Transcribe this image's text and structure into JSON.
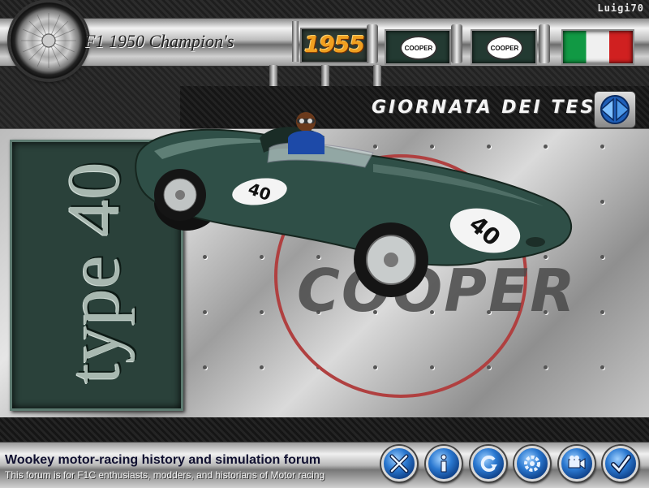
{
  "header": {
    "user_name": "Luigi70",
    "app_title": "F1 1950 Champion's",
    "year": "1955",
    "team_logo_1": "COOPER",
    "team_logo_2": "COOPER",
    "flag": "italy-flag"
  },
  "screen": {
    "title": "GIORNATA DEI TEST",
    "nav_icon": "left-right-arrows-icon"
  },
  "car": {
    "model": "type 40",
    "number": "40",
    "brand": "COOPER",
    "body_color": "#2f4f47"
  },
  "footer": {
    "title": "Wookey motor-racing history and simulation forum",
    "subtitle": "This forum is for F1C enthusiasts, modders, and historians of Motor racing",
    "buttons": [
      {
        "icon": "close-x-icon"
      },
      {
        "icon": "info-icon"
      },
      {
        "icon": "back-arrow-icon"
      },
      {
        "icon": "settings-gear-icon"
      },
      {
        "icon": "camera-icon"
      },
      {
        "icon": "confirm-check-icon"
      }
    ]
  },
  "colors": {
    "accent_blue": "#2a78d0",
    "panel_green": "#2a413a",
    "year_orange": "#f0a020"
  }
}
